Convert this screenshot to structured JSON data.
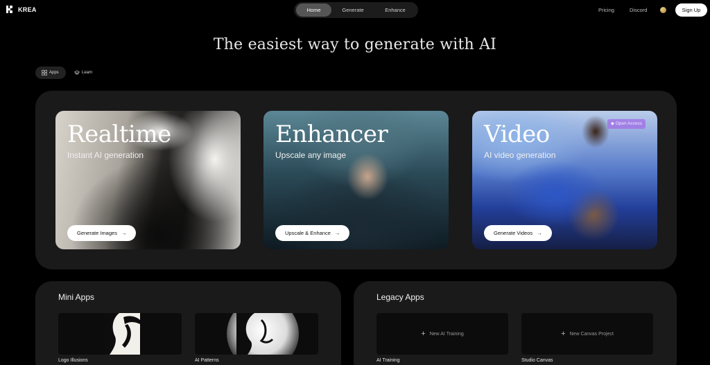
{
  "header": {
    "brand": "KREA",
    "nav_tabs": [
      {
        "label": "Home",
        "active": true
      },
      {
        "label": "Generate",
        "active": false
      },
      {
        "label": "Enhance",
        "active": false
      }
    ],
    "links": {
      "pricing": "Pricing",
      "discord": "Discord"
    },
    "signup_label": "Sign Up"
  },
  "hero": {
    "headline": "The easiest way to generate with AI"
  },
  "segments": [
    {
      "label": "Apps",
      "icon": "grid-icon",
      "active": true
    },
    {
      "label": "Learn",
      "icon": "graduation-cap-icon",
      "active": false
    }
  ],
  "cards": [
    {
      "title": "Realtime",
      "subtitle": "Instant AI generation",
      "button": "Generate Images"
    },
    {
      "title": "Enhancer",
      "subtitle": "Upscale any image",
      "button": "Upscale & Enhance"
    },
    {
      "title": "Video",
      "subtitle": "AI video generation",
      "button": "Generate Videos",
      "badge": "Open Access"
    }
  ],
  "mini_apps": {
    "title": "Mini Apps",
    "items": [
      {
        "label": "Logo Illusions"
      },
      {
        "label": "AI Patterns"
      }
    ]
  },
  "legacy_apps": {
    "title": "Legacy Apps",
    "items": [
      {
        "label": "AI Training",
        "cta": "New AI Training"
      },
      {
        "label": "Studio Canvas",
        "cta": "New Canvas Project"
      }
    ]
  },
  "colors": {
    "background": "#000000",
    "panel": "#1a1a1a",
    "badge": "#a06ee6"
  }
}
